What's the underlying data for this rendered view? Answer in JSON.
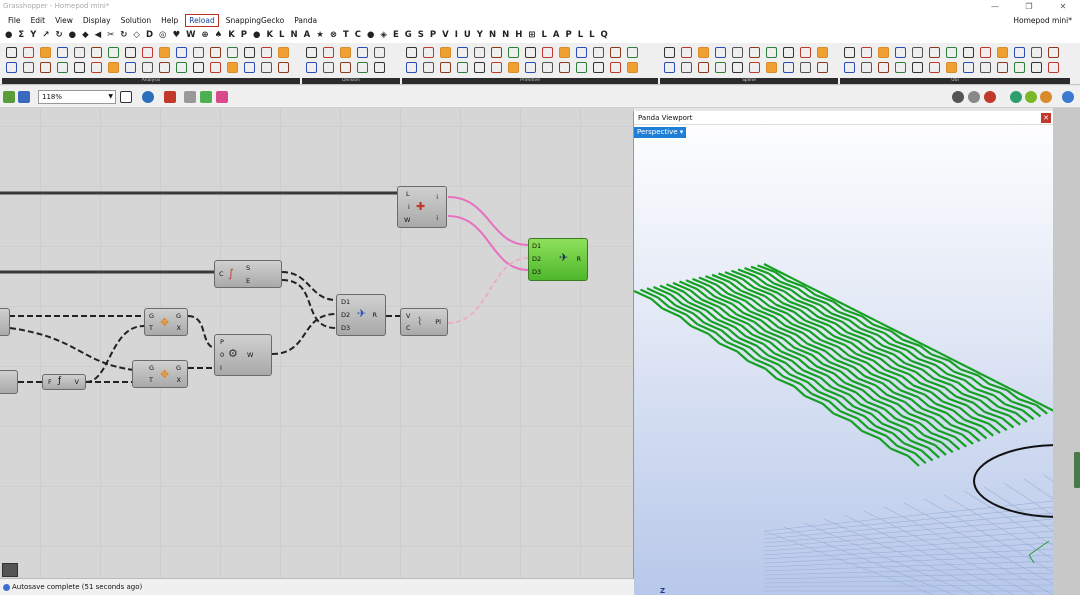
{
  "window": {
    "title": "Grasshopper - Homepod mini*",
    "doc_name": "Homepod mini*"
  },
  "menu": {
    "items": [
      "File",
      "Edit",
      "View",
      "Display",
      "Solution",
      "Help",
      "Reload",
      "SnappingGecko",
      "Panda"
    ]
  },
  "tabs": [
    "●",
    "Σ",
    "Y",
    "↗",
    "↻",
    "●",
    "◆",
    "◀",
    "✂",
    "↻",
    "◇",
    "D",
    "◎",
    "♥",
    "W",
    "⊕",
    "♠",
    "K",
    "P",
    "●",
    "K",
    "L",
    "N",
    "A",
    "★",
    "⊗",
    "T",
    "C",
    "●",
    "◈",
    "E",
    "G",
    "S",
    "P",
    "V",
    "I",
    "U",
    "Y",
    "N",
    "N",
    "H",
    "⊞",
    "L",
    "A",
    "P",
    "L",
    "L",
    "Q"
  ],
  "ribbon": {
    "panels": [
      "Analysis",
      "Division",
      "Primitive",
      "Spline",
      "Util"
    ]
  },
  "toolbar": {
    "zoom": "118%"
  },
  "canvas": {
    "components": [
      {
        "id": "list-item",
        "inputs": [
          "L",
          "i",
          "W"
        ],
        "outputs": [
          "i",
          "i"
        ]
      },
      {
        "id": "curve-frames",
        "inputs": [
          "C"
        ],
        "outputs": [
          "S",
          "E"
        ]
      },
      {
        "id": "evaluate-a",
        "inputs": [
          "G",
          "T"
        ],
        "outputs": [
          "G",
          "X"
        ]
      },
      {
        "id": "evaluate-b",
        "inputs": [
          "G",
          "T"
        ],
        "outputs": [
          "G",
          "X"
        ]
      },
      {
        "id": "solid",
        "inputs": [
          "P",
          "0",
          "I"
        ],
        "outputs": [
          "W"
        ]
      },
      {
        "id": "merge-mid",
        "inputs": [
          "D1",
          "D2",
          "D3"
        ],
        "outputs": [
          "R"
        ]
      },
      {
        "id": "number",
        "inputs": [
          "F"
        ],
        "outputs": [
          "V"
        ]
      },
      {
        "id": "voronoi",
        "inputs": [
          "V",
          "C"
        ],
        "outputs": [
          "Pl"
        ]
      },
      {
        "id": "merge-out",
        "inputs": [
          "D1",
          "D2",
          "D3"
        ],
        "outputs": [
          "R"
        ]
      }
    ]
  },
  "viewport": {
    "title": "Panda Viewport",
    "view": "Perspective",
    "axis": "Z",
    "accent": "#1f7fd6",
    "mesh_color": "#16a023"
  },
  "status": {
    "text": "Autosave complete (51 seconds ago)"
  }
}
